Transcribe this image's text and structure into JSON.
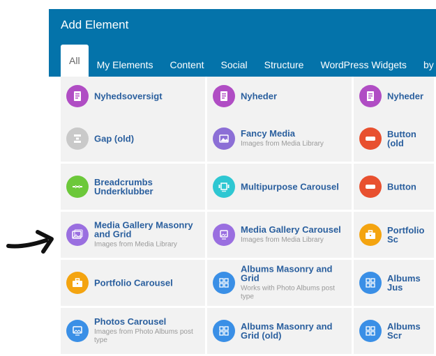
{
  "dialog": {
    "title": "Add Element",
    "tabs": [
      "All",
      "My Elements",
      "Content",
      "Social",
      "Structure",
      "WordPress Widgets",
      "by D"
    ]
  },
  "elements": [
    [
      {
        "name": "Nyhedsoversigt",
        "desc": "",
        "icon": "document-icon",
        "color": "#b04dc4"
      },
      {
        "name": "Nyheder",
        "desc": "",
        "icon": "document-icon",
        "color": "#b04dc4"
      },
      {
        "name": "Nyheder",
        "desc": "",
        "icon": "document-icon",
        "color": "#b04dc4"
      }
    ],
    [
      {
        "name": "Gap (old)",
        "desc": "",
        "icon": "gap-icon",
        "color": "#c9c9c9"
      },
      {
        "name": "Fancy Media",
        "desc": "Images from Media Library",
        "icon": "image-icon",
        "color": "#8c6fd6"
      },
      {
        "name": "Button (old",
        "desc": "",
        "icon": "button-icon",
        "color": "#e8502f"
      }
    ],
    [
      {
        "name": "Breadcrumbs Underklubber",
        "desc": "",
        "icon": "breadcrumbs-icon",
        "color": "#6cc83a"
      },
      {
        "name": "Multipurpose Carousel",
        "desc": "",
        "icon": "carousel-icon",
        "color": "#2ec7d2"
      },
      {
        "name": "Button",
        "desc": "",
        "icon": "button-icon",
        "color": "#e8502f"
      }
    ],
    [
      {
        "name": "Media Gallery Masonry and Grid",
        "desc": "Images from Media Library",
        "icon": "gallery-icon",
        "color": "#9a6fe0"
      },
      {
        "name": "Media Gallery Carousel",
        "desc": "Images from Media Library",
        "icon": "gallery-carousel-icon",
        "color": "#9a6fe0"
      },
      {
        "name": "Portfolio Sc",
        "desc": "",
        "icon": "briefcase-icon",
        "color": "#f4a410"
      }
    ],
    [
      {
        "name": "Portfolio Carousel",
        "desc": "",
        "icon": "briefcase-icon",
        "color": "#f4a410"
      },
      {
        "name": "Albums Masonry and Grid",
        "desc": "Works with Photo Albums post type",
        "icon": "albums-icon",
        "color": "#3a8fe6"
      },
      {
        "name": "Albums Jus",
        "desc": "",
        "icon": "albums-icon",
        "color": "#3a8fe6"
      }
    ],
    [
      {
        "name": "Photos Carousel",
        "desc": "Images from Photo Albums post type",
        "icon": "photos-icon",
        "color": "#3a8fe6"
      },
      {
        "name": "Albums Masonry and Grid (old)",
        "desc": "",
        "icon": "albums-icon",
        "color": "#3a8fe6"
      },
      {
        "name": "Albums Scr",
        "desc": "",
        "icon": "albums-icon",
        "color": "#3a8fe6"
      }
    ]
  ],
  "annotation": {
    "icon": "arrow-right-icon"
  }
}
